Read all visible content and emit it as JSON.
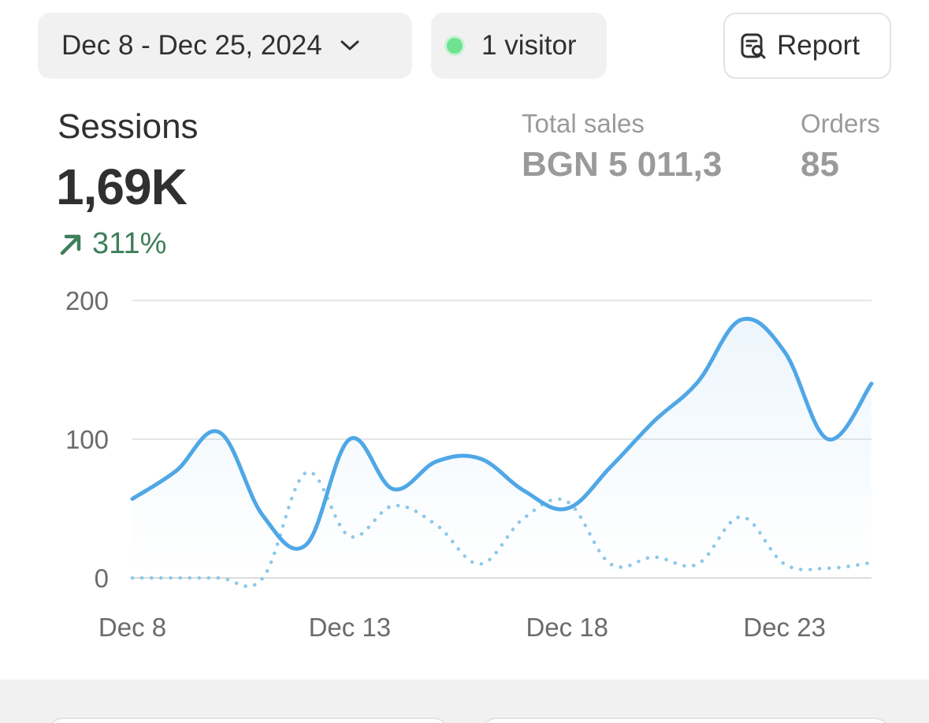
{
  "toolbar": {
    "date_range": "Dec 8 - Dec 25, 2024",
    "visitors": "1 visitor",
    "report_label": "Report"
  },
  "metric": {
    "title": "Sessions",
    "value": "1,69K",
    "change": "311%",
    "change_direction": "up"
  },
  "side_metrics": {
    "sales_label": "Total sales",
    "sales_value": "BGN 5 011,3",
    "orders_label": "Orders",
    "orders_value": "85"
  },
  "colors": {
    "primary_line": "#4fa7e6",
    "comparison_line": "#8cc8ea",
    "positive": "#3f7f5a",
    "status_dot": "#6fe38f"
  },
  "chart_data": {
    "type": "line",
    "x": [
      "Dec 8",
      "Dec 9",
      "Dec 10",
      "Dec 11",
      "Dec 12",
      "Dec 13",
      "Dec 14",
      "Dec 15",
      "Dec 16",
      "Dec 17",
      "Dec 18",
      "Dec 19",
      "Dec 20",
      "Dec 21",
      "Dec 22",
      "Dec 23",
      "Dec 24",
      "Dec 25"
    ],
    "x_tick_labels": [
      "Dec 8",
      "Dec 13",
      "Dec 18",
      "Dec 23"
    ],
    "ylim": [
      0,
      200
    ],
    "y_ticks": [
      0,
      100,
      200
    ],
    "grid": true,
    "series": [
      {
        "style": "solid",
        "values": [
          57,
          77,
          105,
          45,
          24,
          100,
          64,
          84,
          86,
          63,
          50,
          80,
          113,
          141,
          186,
          163,
          100,
          140
        ]
      },
      {
        "style": "dotted",
        "values": [
          0,
          0,
          0,
          0,
          76,
          30,
          52,
          38,
          10,
          43,
          55,
          10,
          15,
          10,
          44,
          10,
          7,
          11
        ]
      }
    ]
  }
}
